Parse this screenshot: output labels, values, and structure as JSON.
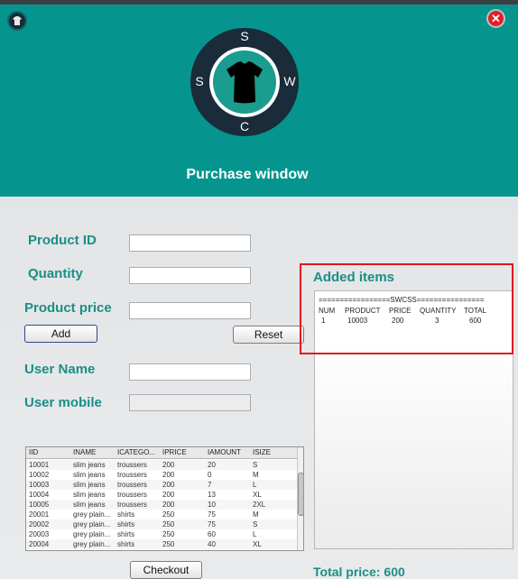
{
  "window": {
    "title": "Purchase window"
  },
  "logo": {
    "letters": {
      "top": "S",
      "left": "S",
      "right": "W",
      "bottom": "C"
    },
    "icon": "shirt-icon"
  },
  "colors": {
    "header": "#05958e",
    "accent_text": "#1a8f86",
    "close": "#e01f2a",
    "highlight": "#e2151f"
  },
  "form": {
    "product_id_label": "Product ID",
    "quantity_label": "Quantity",
    "price_label": "Product price",
    "user_name_label": "User Name",
    "user_mobile_label": "User mobile",
    "product_id_value": "",
    "quantity_value": "",
    "price_value": "",
    "user_name_value": "",
    "user_mobile_value": ""
  },
  "buttons": {
    "add": "Add",
    "reset": "Reset",
    "checkout": "Checkout"
  },
  "table": {
    "headers": [
      "IID",
      "INAME",
      "ICATEGO...",
      "IPRICE",
      "IAMOUNT",
      "ISIZE"
    ],
    "rows": [
      [
        "10001",
        "slim jeans",
        "troussers",
        "200",
        "20",
        "S"
      ],
      [
        "10002",
        "slim jeans",
        "troussers",
        "200",
        "0",
        "M"
      ],
      [
        "10003",
        "slim jeans",
        "troussers",
        "200",
        "7",
        "L"
      ],
      [
        "10004",
        "slim jeans",
        "troussers",
        "200",
        "13",
        "XL"
      ],
      [
        "10005",
        "slim jeans",
        "troussers",
        "200",
        "10",
        "2XL"
      ],
      [
        "20001",
        "grey plain...",
        "shirts",
        "250",
        "75",
        "M"
      ],
      [
        "20002",
        "grey plain...",
        "shirts",
        "250",
        "75",
        "S"
      ],
      [
        "20003",
        "grey plain...",
        "shirts",
        "250",
        "60",
        "L"
      ],
      [
        "20004",
        "grey plain...",
        "shirts",
        "250",
        "40",
        "XL"
      ]
    ]
  },
  "added": {
    "title": "Added items",
    "banner": "=================SWCSS================",
    "columns": [
      "NUM",
      "PRODUCT",
      "PRICE",
      "QUANTITY",
      "TOTAL"
    ],
    "items": [
      [
        "1",
        "10003",
        "200",
        "3",
        "600"
      ]
    ]
  },
  "total": {
    "label": "Total price:",
    "value": "600"
  }
}
